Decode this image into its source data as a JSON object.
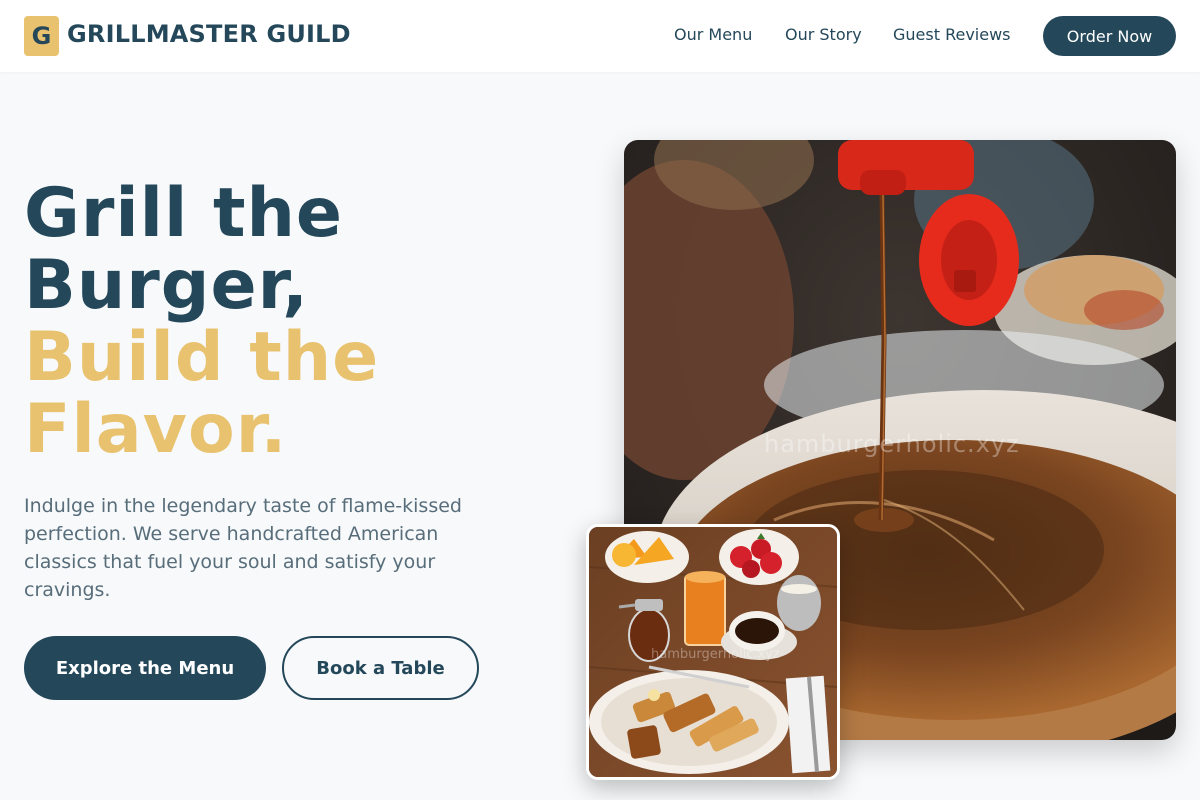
{
  "brand": {
    "logo_letter": "G",
    "name": "GRILLMASTER GUILD"
  },
  "nav": {
    "items": [
      {
        "label": "Our Menu"
      },
      {
        "label": "Our Story"
      },
      {
        "label": "Guest Reviews"
      }
    ],
    "cta_label": "Order Now"
  },
  "hero": {
    "title_line1": "Grill the",
    "title_line2": "Burger,",
    "title_line3": "Build the",
    "title_line4": "Flavor.",
    "description": "Indulge in the legendary taste of flame-kissed perfection. We serve handcrafted American classics that fuel your soul and satisfy your cravings.",
    "primary_button": "Explore the Menu",
    "secondary_button": "Book a Table"
  },
  "images": {
    "main_watermark": "hamburgerholic.xyz",
    "inset_watermark": "hamburgerholic.xyz"
  },
  "colors": {
    "primary": "#24485a",
    "accent": "#e8c26e",
    "background": "#f7f9fb"
  }
}
